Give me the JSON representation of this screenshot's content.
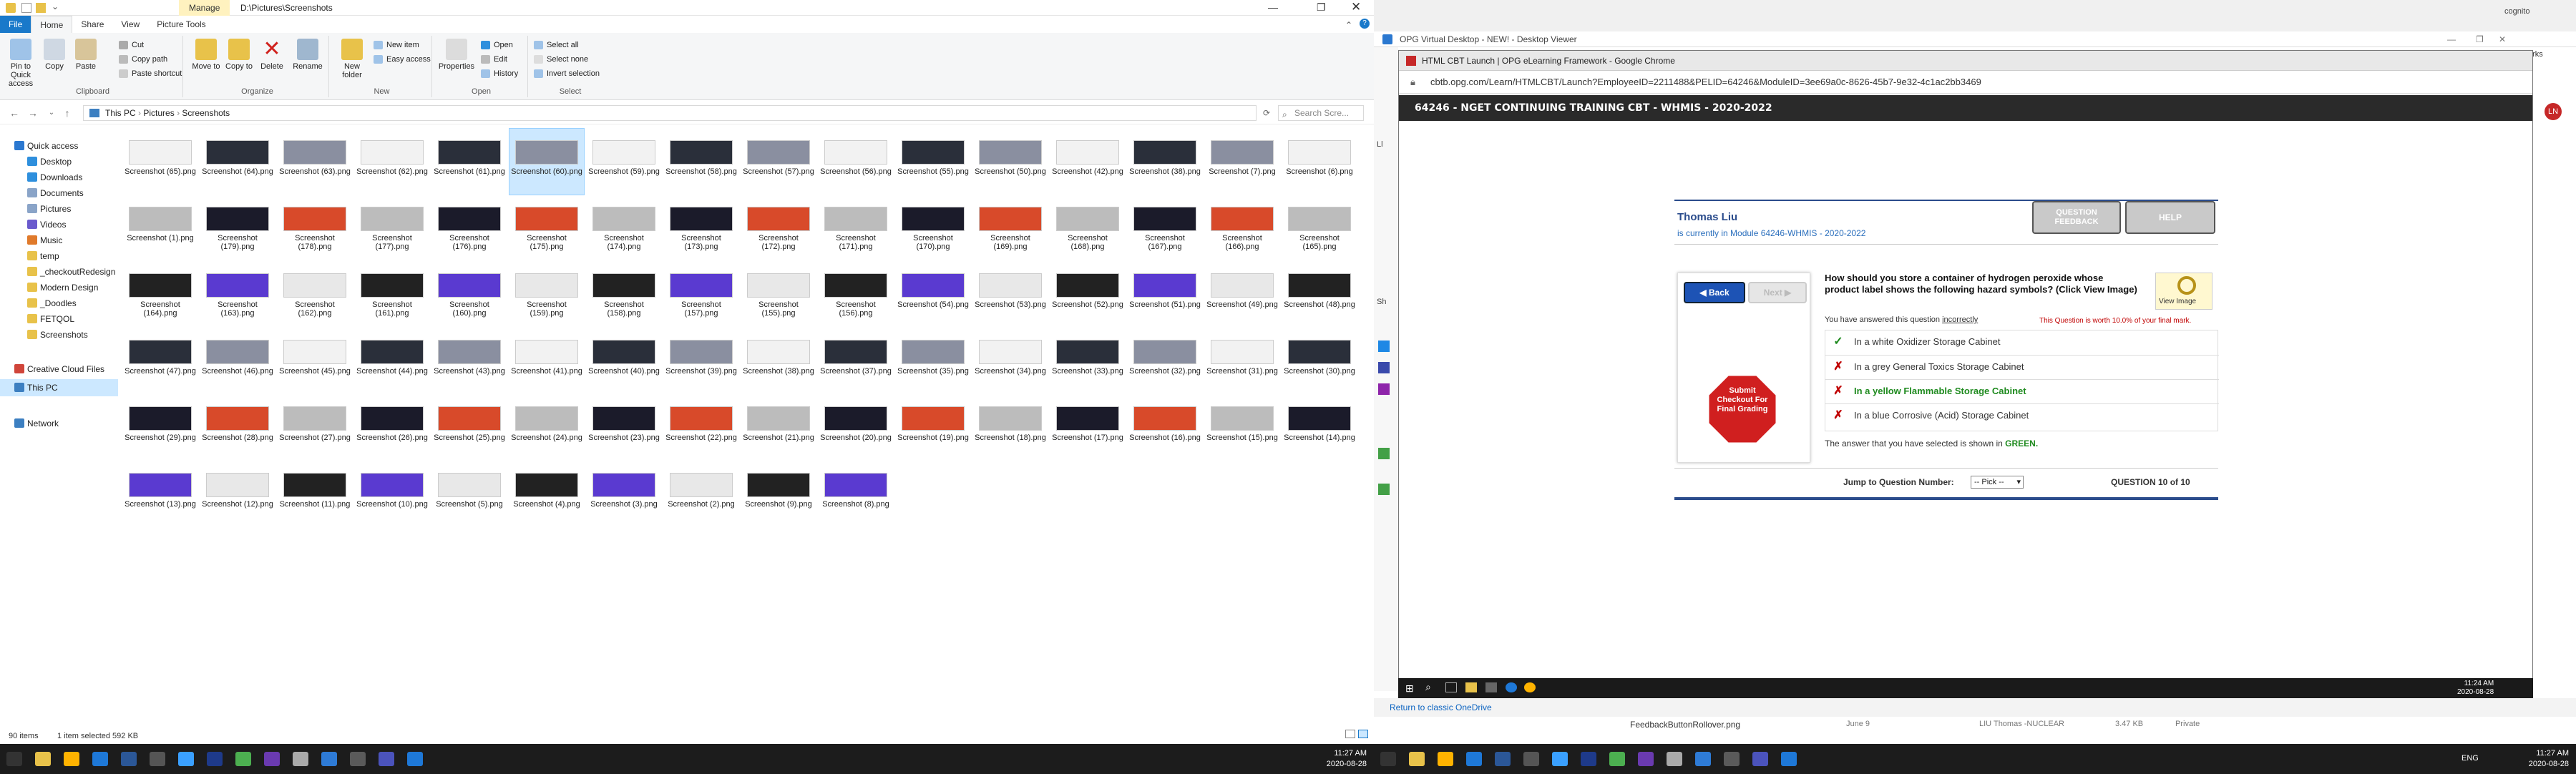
{
  "explorer": {
    "title_tab_manage": "Manage",
    "title_path": "D:\\Pictures\\Screenshots",
    "tabs": [
      "File",
      "Home",
      "Share",
      "View",
      "Picture Tools"
    ],
    "ribbon": {
      "clipboard": {
        "pin": "Pin to Quick access",
        "copy": "Copy",
        "paste": "Paste",
        "cut": "Cut",
        "copy_path": "Copy path",
        "paste_shortcut": "Paste shortcut",
        "label": "Clipboard"
      },
      "organize": {
        "move_to": "Move to",
        "copy_to": "Copy to",
        "delete": "Delete",
        "rename": "Rename",
        "label": "Organize"
      },
      "new": {
        "new_folder": "New folder",
        "new_item": "New item",
        "easy_access": "Easy access",
        "label": "New"
      },
      "open": {
        "properties": "Properties",
        "open": "Open",
        "edit": "Edit",
        "history": "History",
        "label": "Open"
      },
      "select": {
        "select_all": "Select all",
        "select_none": "Select none",
        "invert": "Invert selection",
        "label": "Select"
      }
    },
    "breadcrumb": [
      "This PC",
      "Pictures",
      "Screenshots"
    ],
    "search_placeholder": "Search Scre...",
    "nav": [
      {
        "label": "Quick access",
        "icon": "star-icon",
        "color": "#2b78d0",
        "indent": 0
      },
      {
        "label": "Desktop",
        "icon": "desktop-icon",
        "color": "#2e8fdd",
        "indent": 1
      },
      {
        "label": "Downloads",
        "icon": "download-icon",
        "color": "#2e8fdd",
        "indent": 1
      },
      {
        "label": "Documents",
        "icon": "documents-icon",
        "color": "#8aa4c8",
        "indent": 1
      },
      {
        "label": "Pictures",
        "icon": "pictures-icon",
        "color": "#8aa4c8",
        "indent": 1
      },
      {
        "label": "Videos",
        "icon": "videos-icon",
        "color": "#6a5acd",
        "indent": 1
      },
      {
        "label": "Music",
        "icon": "music-icon",
        "color": "#e07a2b",
        "indent": 1
      },
      {
        "label": "temp",
        "icon": "folder-icon",
        "color": "#e8c24a",
        "indent": 1
      },
      {
        "label": "_checkoutRedesign",
        "icon": "folder-icon",
        "color": "#e8c24a",
        "indent": 1
      },
      {
        "label": "Modern Design",
        "icon": "folder-icon",
        "color": "#e8c24a",
        "indent": 1
      },
      {
        "label": "_Doodles",
        "icon": "folder-icon",
        "color": "#e8c24a",
        "indent": 1
      },
      {
        "label": "FETQOL",
        "icon": "folder-icon",
        "color": "#e8c24a",
        "indent": 1
      },
      {
        "label": "Screenshots",
        "icon": "folder-icon",
        "color": "#e8c24a",
        "indent": 1
      },
      {
        "label": "Creative Cloud Files",
        "icon": "cloud-icon",
        "color": "#d0453a",
        "indent": 0
      },
      {
        "label": "This PC",
        "icon": "computer-icon",
        "color": "#3c7fc1",
        "indent": 0,
        "selected": true
      },
      {
        "label": "Network",
        "icon": "network-icon",
        "color": "#3c7fc1",
        "indent": 0
      }
    ],
    "files": [
      [
        "Screenshot (65).png",
        "Screenshot (64).png",
        "Screenshot (63).png",
        "Screenshot (62).png",
        "Screenshot (61).png",
        "Screenshot (60).png",
        "Screenshot (59).png",
        "Screenshot (58).png",
        "Screenshot (57).png",
        "Screenshot (56).png",
        "Screenshot (55).png",
        "Screenshot (50).png",
        "Screenshot (42).png",
        "Screenshot (38).png",
        "Screenshot (7).png",
        "Screenshot (6).png"
      ],
      [
        "Screenshot (1).png",
        "Screenshot (179).png",
        "Screenshot (178).png",
        "Screenshot (177).png",
        "Screenshot (176).png",
        "Screenshot (175).png",
        "Screenshot (174).png",
        "Screenshot (173).png",
        "Screenshot (172).png",
        "Screenshot (171).png",
        "Screenshot (170).png",
        "Screenshot (169).png",
        "Screenshot (168).png",
        "Screenshot (167).png",
        "Screenshot (166).png",
        "Screenshot (165).png"
      ],
      [
        "Screenshot (164).png",
        "Screenshot (163).png",
        "Screenshot (162).png",
        "Screenshot (161).png",
        "Screenshot (160).png",
        "Screenshot (159).png",
        "Screenshot (158).png",
        "Screenshot (157).png",
        "Screenshot (155).png",
        "Screenshot (156).png",
        "Screenshot (54).png",
        "Screenshot (53).png",
        "Screenshot (52).png",
        "Screenshot (51).png",
        "Screenshot (49).png",
        "Screenshot (48).png"
      ],
      [
        "Screenshot (47).png",
        "Screenshot (46).png",
        "Screenshot (45).png",
        "Screenshot (44).png",
        "Screenshot (43).png",
        "Screenshot (41).png",
        "Screenshot (40).png",
        "Screenshot (39).png",
        "Screenshot (38).png",
        "Screenshot (37).png",
        "Screenshot (35).png",
        "Screenshot (34).png",
        "Screenshot (33).png",
        "Screenshot (32).png",
        "Screenshot (31).png",
        "Screenshot (30).png"
      ],
      [
        "Screenshot (29).png",
        "Screenshot (28).png",
        "Screenshot (27).png",
        "Screenshot (26).png",
        "Screenshot (25).png",
        "Screenshot (24).png",
        "Screenshot (23).png",
        "Screenshot (22).png",
        "Screenshot (21).png",
        "Screenshot (20).png",
        "Screenshot (19).png",
        "Screenshot (18).png",
        "Screenshot (17).png",
        "Screenshot (16).png",
        "Screenshot (15).png",
        "Screenshot (14).png"
      ],
      [
        "Screenshot (13).png",
        "Screenshot (12).png",
        "Screenshot (11).png",
        "Screenshot (10).png",
        "Screenshot (5).png",
        "Screenshot (4).png",
        "Screenshot (3).png",
        "Screenshot (2).png",
        "Screenshot (9).png",
        "Screenshot (8).png"
      ]
    ],
    "status_count": "90 items",
    "status_selected": "1 item selected  592 KB"
  },
  "viewer": {
    "title": "OPG Virtual Desktop - NEW! - Desktop Viewer",
    "chrome_title": "HTML CBT Launch | OPG eLearning Framework - Google Chrome",
    "url": "cbtb.opg.com/Learn/HTMLCBT/Launch?EmployeeID=2211488&PELID=64246&ModuleID=3ee69a0c-8626-45b7-9e32-4c1ac2bb3469",
    "course_title": "64246 - NGET CONTINUING TRAINING CBT - WHMIS - 2020-2022",
    "user_name": "Thomas Liu",
    "module_text": "is currently in Module 64246-WHMIS - 2020-2022",
    "btn_question_feedback": "QUESTION FEEDBACK",
    "btn_help": "HELP",
    "btn_back": "Back",
    "btn_next": "Next",
    "question": "How should you store a container of hydrogen peroxide whose product label shows the following hazard symbols? (Click View Image)",
    "view_image": "View Image",
    "answered_prefix": "You have answered this question ",
    "answered_status": "incorrectly",
    "worth": "This Question is worth 10.0% of your final mark.",
    "options": [
      {
        "text": "In a white Oxidizer Storage Cabinet",
        "mark": "check",
        "style": "normal"
      },
      {
        "text": "In a grey General Toxics Storage Cabinet",
        "mark": "x",
        "style": "normal"
      },
      {
        "text": "In a yellow Flammable Storage Cabinet",
        "mark": "x",
        "style": "selected"
      },
      {
        "text": "In a blue Corrosive (Acid) Storage Cabinet",
        "mark": "x",
        "style": "normal"
      }
    ],
    "answer_note_prefix": "The answer that you have selected is shown in ",
    "answer_note_color": "GREEN.",
    "submit_text": "Submit Checkout For Final Grading",
    "jump_label": "Jump to Question Number:",
    "jump_value": "-- Pick --",
    "question_counter": "QUESTION 10 of 10",
    "inner_time": "11:24 AM",
    "inner_date": "2020-08-28",
    "onedrive_link": "Return to classic OneDrive",
    "onedrive_file": "FeedbackButtonRollover.png",
    "onedrive_meta1": "June 9",
    "onedrive_meta2": "LIU Thomas -NUCLEAR",
    "onedrive_meta3": "3.47 KB",
    "onedrive_meta4": "Private",
    "chrome_side_label": "Ll",
    "chrome_side_label2": "Sh",
    "incognito": "cognito",
    "bookmarks": "bookmarks",
    "avatar": "LN"
  },
  "taskbar_left": {
    "time": "11:27 AM",
    "date": "2020-08-28"
  },
  "taskbar_right": {
    "time": "11:27 AM",
    "date": "2020-08-28",
    "lang": "ENG"
  },
  "colors": {
    "accent": "#1979ca",
    "selected_tile": "#cce8ff",
    "answer_green": "#1e8a1e",
    "incorrect_red": "#c00000",
    "lms_blue": "#2b4c8c"
  }
}
